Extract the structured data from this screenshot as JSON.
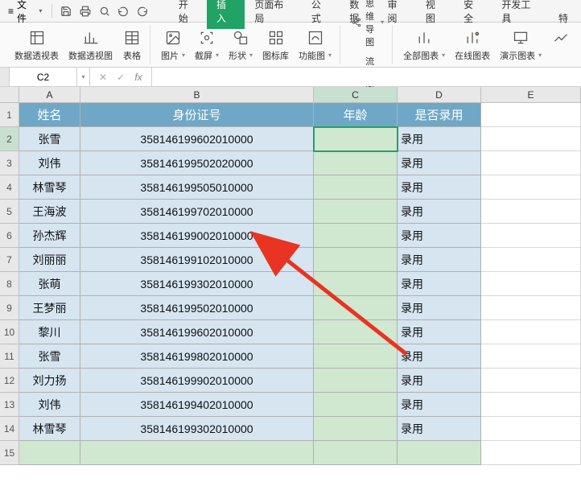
{
  "menu": {
    "file": "文件",
    "tabs": [
      "开始",
      "插入",
      "页面布局",
      "公式",
      "数据",
      "审阅",
      "视图",
      "安全",
      "开发工具",
      "特"
    ],
    "active_tab": 1
  },
  "ribbon": {
    "pivot_table": "数据透视表",
    "pivot_chart": "数据透视图",
    "table": "表格",
    "picture": "图片",
    "screenshot": "截屏",
    "shapes": "形状",
    "icons": "图标库",
    "function_plot": "功能图",
    "mindmap": "思维导图",
    "flowchart": "流程图",
    "all_charts": "全部图表",
    "online_chart": "在线图表",
    "present_chart": "演示图表"
  },
  "namebox": {
    "value": "C2"
  },
  "columns": [
    "A",
    "B",
    "C",
    "D",
    "E"
  ],
  "headers": [
    "姓名",
    "身份证号",
    "年龄",
    "是否录用"
  ],
  "rows": [
    {
      "name": "张雪",
      "id": "358146199602010000",
      "age": "",
      "status": "录用"
    },
    {
      "name": "刘伟",
      "id": "358146199502020000",
      "age": "",
      "status": "录用"
    },
    {
      "name": "林雪琴",
      "id": "358146199505010000",
      "age": "",
      "status": "录用"
    },
    {
      "name": "王海波",
      "id": "358146199702010000",
      "age": "",
      "status": "录用"
    },
    {
      "name": "孙杰辉",
      "id": "358146199002010000",
      "age": "",
      "status": "录用"
    },
    {
      "name": "刘丽丽",
      "id": "358146199102010000",
      "age": "",
      "status": "录用"
    },
    {
      "name": "张萌",
      "id": "358146199302010000",
      "age": "",
      "status": "录用"
    },
    {
      "name": "王梦丽",
      "id": "358146199502010000",
      "age": "",
      "status": "录用"
    },
    {
      "name": "黎川",
      "id": "358146199602010000",
      "age": "",
      "status": "录用"
    },
    {
      "name": "张雪",
      "id": "358146199802010000",
      "age": "",
      "status": "录用"
    },
    {
      "name": "刘力扬",
      "id": "358146199902010000",
      "age": "",
      "status": "录用"
    },
    {
      "name": "刘伟",
      "id": "358146199402010000",
      "age": "",
      "status": "录用"
    },
    {
      "name": "林雪琴",
      "id": "358146199302010000",
      "age": "",
      "status": "录用"
    }
  ],
  "selected_cell": "C2",
  "active_col": "C",
  "active_row": 2
}
